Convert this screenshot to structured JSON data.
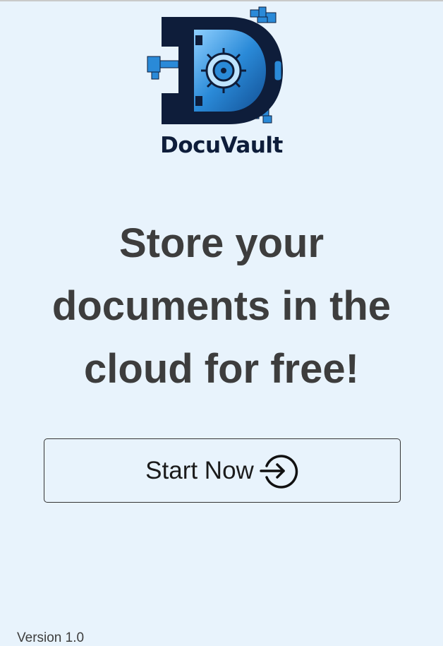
{
  "app": {
    "logo_text": "DocuVault",
    "headline": "Store your documents in the cloud for free!",
    "start_button_label": "Start Now",
    "version": "Version 1.0"
  },
  "icons": {
    "logo": "docuvault-logo-icon",
    "start": "arrow-circle-right-icon"
  },
  "colors": {
    "background": "#e8f3fc",
    "headline": "#3d3d3d",
    "logo_dark": "#0e1d3a",
    "logo_blue": "#2a8ad8"
  }
}
